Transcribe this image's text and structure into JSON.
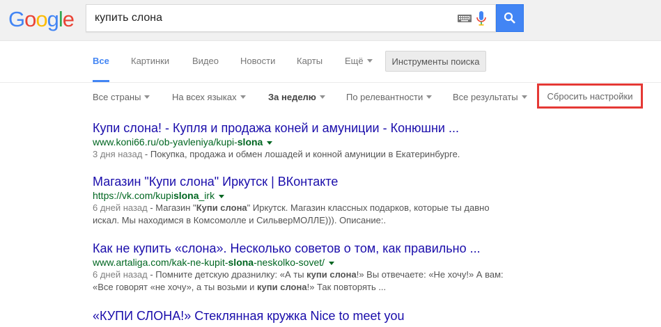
{
  "search": {
    "query": "купить слона",
    "logo_letters": [
      {
        "ch": "G",
        "color": "#4285f4"
      },
      {
        "ch": "o",
        "color": "#ea4335"
      },
      {
        "ch": "o",
        "color": "#fbbc05"
      },
      {
        "ch": "g",
        "color": "#4285f4"
      },
      {
        "ch": "l",
        "color": "#34a853"
      },
      {
        "ch": "e",
        "color": "#ea4335"
      }
    ]
  },
  "tabs": {
    "all": "Все",
    "images": "Картинки",
    "video": "Видео",
    "news": "Новости",
    "maps": "Карты",
    "more": "Ещё",
    "tools": "Инструменты поиска"
  },
  "filters": {
    "country": "Все страны",
    "language": "На всех языках",
    "time": "За неделю",
    "sort": "По релевантности",
    "results": "Все результаты",
    "reset": "Сбросить настройки"
  },
  "results": [
    {
      "title": "Купи слона! - Купля и продажа коней и амуниции - Конюшни ...",
      "url_pre": "www.koni66.ru/ob-yavleniya/kupi-",
      "url_bold": "slona",
      "url_post": "",
      "date": "3 дня назад",
      "snippet": " - Покупка, продажа и обмен лошадей и конной амуниции в Екатеринбурге."
    },
    {
      "title": "Магазин \"Купи слона\" Иркутск | ВКонтакте",
      "url_pre": "https://vk.com/kupi",
      "url_bold": "slona",
      "url_post": "_irk",
      "date": "6 дней назад",
      "s1": " - Магазин \"",
      "s1b": "Купи слона",
      "s2": "\" Иркутск. Магазин классных подарков, которые ты давно искал. Мы находимся в Комсомолле и СильверМОЛЛЕ))). Описание:."
    },
    {
      "title": "Как не купить «слона». Несколько советов о том, как правильно ...",
      "url_pre": "www.artaliga.com/kak-ne-kupit-",
      "url_bold": "slona",
      "url_post": "-neskolko-sovet/",
      "date": "6 дней назад",
      "s1": " - Помните детскую дразнилку: «А ты ",
      "s1b": "купи слона",
      "s2": "!» Вы отвечаете: «Не хочу!» А вам: «Все говорят «не хочу», а ты возьми и ",
      "s2b": "купи слона",
      "s3": "!» Так повторять ..."
    },
    {
      "title": "«КУПИ СЛОНА!» Стеклянная кружка Nice to meet you"
    }
  ]
}
